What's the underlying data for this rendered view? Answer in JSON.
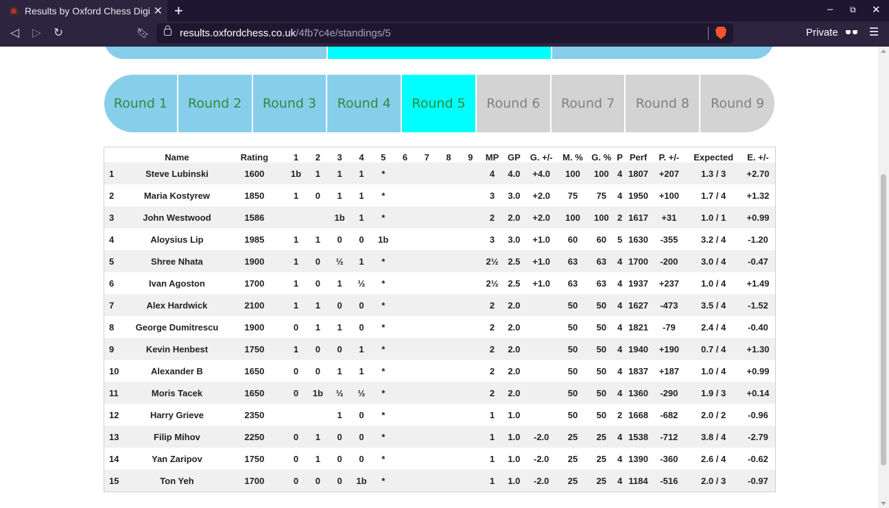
{
  "browser": {
    "tab_title": "Results by Oxford Chess Digital",
    "new_tab": "+",
    "close": "✕",
    "url_host": "results.oxfordchess.co.uk",
    "url_path": "/4fb7c4e/standings/5",
    "private_label": "Private"
  },
  "rounds": [
    {
      "label": "Round 1",
      "state": "done"
    },
    {
      "label": "Round 2",
      "state": "done"
    },
    {
      "label": "Round 3",
      "state": "done"
    },
    {
      "label": "Round 4",
      "state": "done"
    },
    {
      "label": "Round 5",
      "state": "active"
    },
    {
      "label": "Round 6",
      "state": "future"
    },
    {
      "label": "Round 7",
      "state": "future"
    },
    {
      "label": "Round 8",
      "state": "future"
    },
    {
      "label": "Round 9",
      "state": "future"
    }
  ],
  "colors": {
    "done": "#87ceeb",
    "active": "#00ffff",
    "future": "#d3d3d3",
    "round_text": "#2f8a3c"
  },
  "table": {
    "headers": [
      "",
      "Name",
      "Rating",
      "1",
      "2",
      "3",
      "4",
      "5",
      "6",
      "7",
      "8",
      "9",
      "MP",
      "GP",
      "G. +/-",
      "M. %",
      "G. %",
      "P",
      "Perf",
      "P. +/-",
      "Expected",
      "E. +/-"
    ],
    "rows": [
      [
        "1",
        "Steve Lubinski",
        "1600",
        "1b",
        "1",
        "1",
        "1",
        "*",
        "",
        "",
        "",
        "",
        "4",
        "4.0",
        "+4.0",
        "100",
        "100",
        "4",
        "1807",
        "+207",
        "1.3 / 3",
        "+2.70"
      ],
      [
        "2",
        "Maria Kostyrew",
        "1850",
        "1",
        "0",
        "1",
        "1",
        "*",
        "",
        "",
        "",
        "",
        "3",
        "3.0",
        "+2.0",
        "75",
        "75",
        "4",
        "1950",
        "+100",
        "1.7 / 4",
        "+1.32"
      ],
      [
        "3",
        "John Westwood",
        "1586",
        "",
        "",
        "1b",
        "1",
        "*",
        "",
        "",
        "",
        "",
        "2",
        "2.0",
        "+2.0",
        "100",
        "100",
        "2",
        "1617",
        "+31",
        "1.0 / 1",
        "+0.99"
      ],
      [
        "4",
        "Aloysius Lip",
        "1985",
        "1",
        "1",
        "0",
        "0",
        "1b",
        "",
        "",
        "",
        "",
        "3",
        "3.0",
        "+1.0",
        "60",
        "60",
        "5",
        "1630",
        "-355",
        "3.2 / 4",
        "-1.20"
      ],
      [
        "5",
        "Shree Nhata",
        "1900",
        "1",
        "0",
        "½",
        "1",
        "*",
        "",
        "",
        "",
        "",
        "2½",
        "2.5",
        "+1.0",
        "63",
        "63",
        "4",
        "1700",
        "-200",
        "3.0 / 4",
        "-0.47"
      ],
      [
        "6",
        "Ivan Agoston",
        "1700",
        "1",
        "0",
        "1",
        "½",
        "*",
        "",
        "",
        "",
        "",
        "2½",
        "2.5",
        "+1.0",
        "63",
        "63",
        "4",
        "1937",
        "+237",
        "1.0 / 4",
        "+1.49"
      ],
      [
        "7",
        "Alex Hardwick",
        "2100",
        "1",
        "1",
        "0",
        "0",
        "*",
        "",
        "",
        "",
        "",
        "2",
        "2.0",
        "",
        "50",
        "50",
        "4",
        "1627",
        "-473",
        "3.5 / 4",
        "-1.52"
      ],
      [
        "8",
        "George Dumitrescu",
        "1900",
        "0",
        "1",
        "1",
        "0",
        "*",
        "",
        "",
        "",
        "",
        "2",
        "2.0",
        "",
        "50",
        "50",
        "4",
        "1821",
        "-79",
        "2.4 / 4",
        "-0.40"
      ],
      [
        "9",
        "Kevin Henbest",
        "1750",
        "1",
        "0",
        "0",
        "1",
        "*",
        "",
        "",
        "",
        "",
        "2",
        "2.0",
        "",
        "50",
        "50",
        "4",
        "1940",
        "+190",
        "0.7 / 4",
        "+1.30"
      ],
      [
        "10",
        "Alexander B",
        "1650",
        "0",
        "0",
        "1",
        "1",
        "*",
        "",
        "",
        "",
        "",
        "2",
        "2.0",
        "",
        "50",
        "50",
        "4",
        "1837",
        "+187",
        "1.0 / 4",
        "+0.99"
      ],
      [
        "11",
        "Moris Tacek",
        "1650",
        "0",
        "1b",
        "½",
        "½",
        "*",
        "",
        "",
        "",
        "",
        "2",
        "2.0",
        "",
        "50",
        "50",
        "4",
        "1360",
        "-290",
        "1.9 / 3",
        "+0.14"
      ],
      [
        "12",
        "Harry Grieve",
        "2350",
        "",
        "",
        "1",
        "0",
        "*",
        "",
        "",
        "",
        "",
        "1",
        "1.0",
        "",
        "50",
        "50",
        "2",
        "1668",
        "-682",
        "2.0 / 2",
        "-0.96"
      ],
      [
        "13",
        "Filip Mihov",
        "2250",
        "0",
        "1",
        "0",
        "0",
        "*",
        "",
        "",
        "",
        "",
        "1",
        "1.0",
        "-2.0",
        "25",
        "25",
        "4",
        "1538",
        "-712",
        "3.8 / 4",
        "-2.79"
      ],
      [
        "14",
        "Yan Zaripov",
        "1750",
        "0",
        "1",
        "0",
        "0",
        "*",
        "",
        "",
        "",
        "",
        "1",
        "1.0",
        "-2.0",
        "25",
        "25",
        "4",
        "1390",
        "-360",
        "2.6 / 4",
        "-0.62"
      ],
      [
        "15",
        "Ton Yeh",
        "1700",
        "0",
        "0",
        "0",
        "1b",
        "*",
        "",
        "",
        "",
        "",
        "1",
        "1.0",
        "-2.0",
        "25",
        "25",
        "4",
        "1184",
        "-516",
        "2.0 / 3",
        "-0.97"
      ]
    ]
  }
}
